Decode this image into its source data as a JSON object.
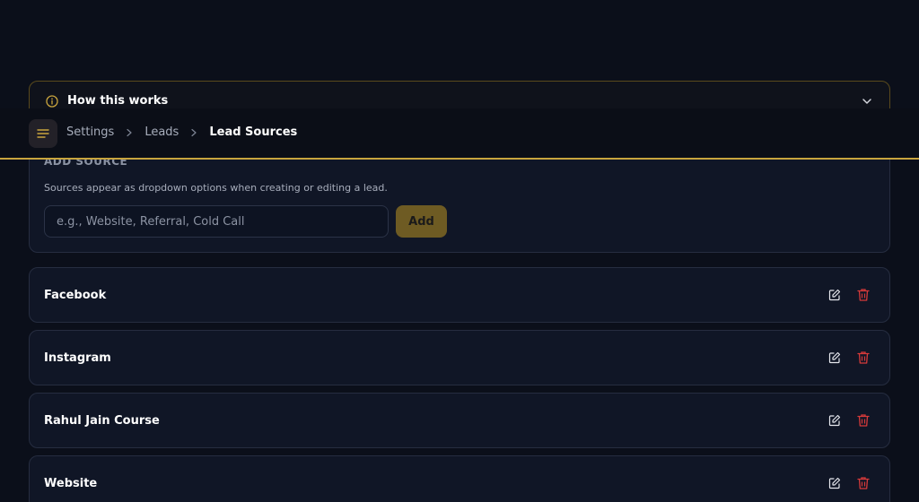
{
  "how_it_works": {
    "title": "How this works",
    "icon": "info-icon"
  },
  "header": {
    "menu_icon": "menu-icon",
    "breadcrumb": [
      {
        "label": "Settings"
      },
      {
        "label": "Leads"
      },
      {
        "label": "Lead Sources"
      }
    ],
    "accent_color": "#c9a53e"
  },
  "add_source": {
    "title": "ADD SOURCE",
    "description": "Sources appear as dropdown options when creating or editing a lead.",
    "input": {
      "value": "",
      "placeholder": "e.g., Website, Referral, Cold Call"
    },
    "button_label": "Add"
  },
  "sources": [
    {
      "name": "Facebook"
    },
    {
      "name": "Instagram"
    },
    {
      "name": "Rahul Jain Course"
    },
    {
      "name": "Website"
    }
  ],
  "colors": {
    "background": "#0b0f1a",
    "card": "#101626",
    "accent": "#c9a53e",
    "delete": "#d63a3a"
  }
}
